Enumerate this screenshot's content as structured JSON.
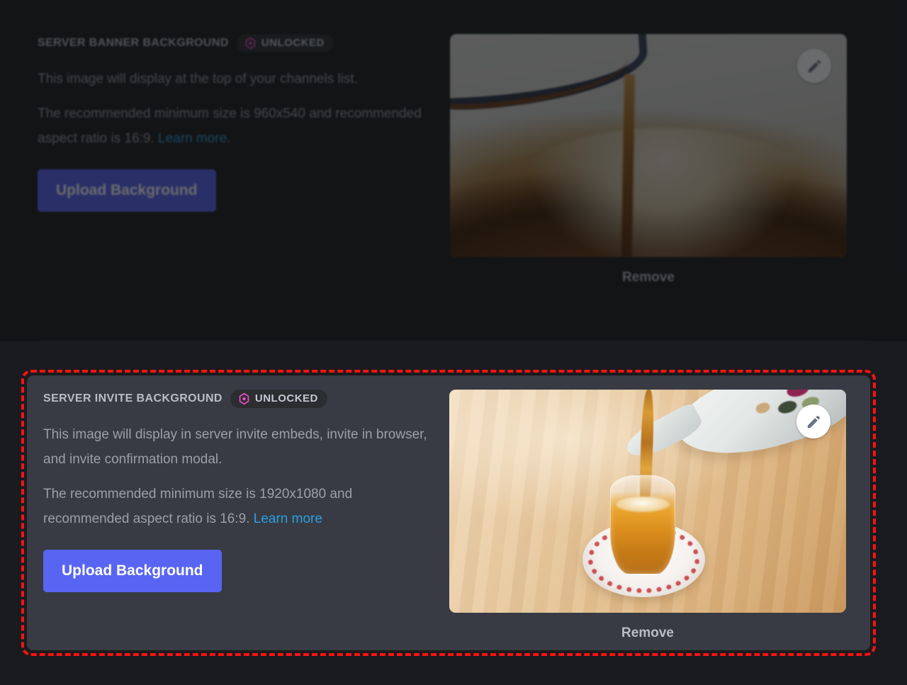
{
  "theme": {
    "page_background": "#1a1b1e",
    "panel_background": "#383b43",
    "accent_blurple": "#5865F2",
    "link_blue": "#2a9fe0",
    "badge_pink": "#ef4ec4",
    "highlight_red": "#ff1111"
  },
  "sections": [
    {
      "id": "server-banner-background",
      "title": "SERVER BANNER BACKGROUND",
      "badge": {
        "icon": "boost-diamond-icon",
        "label": "UNLOCKED"
      },
      "description": "This image will display at the top of your channels list.",
      "recommendation_prefix": "The recommended minimum size is 960x540 and recommended aspect ratio is 16:9. ",
      "recommendation_link": "Learn more",
      "recommendation_suffix": ".",
      "upload_label": "Upload Background",
      "remove_label": "Remove",
      "edit_icon": "pencil-icon",
      "preview_alt": "Tea being poured from a teapot into a cup",
      "state": "dimmed"
    },
    {
      "id": "server-invite-background",
      "title": "SERVER INVITE BACKGROUND",
      "badge": {
        "icon": "boost-diamond-icon",
        "label": "UNLOCKED"
      },
      "description": "This image will display in server invite embeds, invite in browser, and invite confirmation modal.",
      "recommendation_prefix": "The recommended minimum size is 1920x1080 and recommended aspect ratio is 16:9. ",
      "recommendation_link": "Learn more",
      "recommendation_suffix": "",
      "upload_label": "Upload Background",
      "remove_label": "Remove",
      "edit_icon": "pencil-icon",
      "preview_alt": "Turkish tea poured into a glass on a saucer on a wooden table",
      "state": "highlighted"
    }
  ]
}
